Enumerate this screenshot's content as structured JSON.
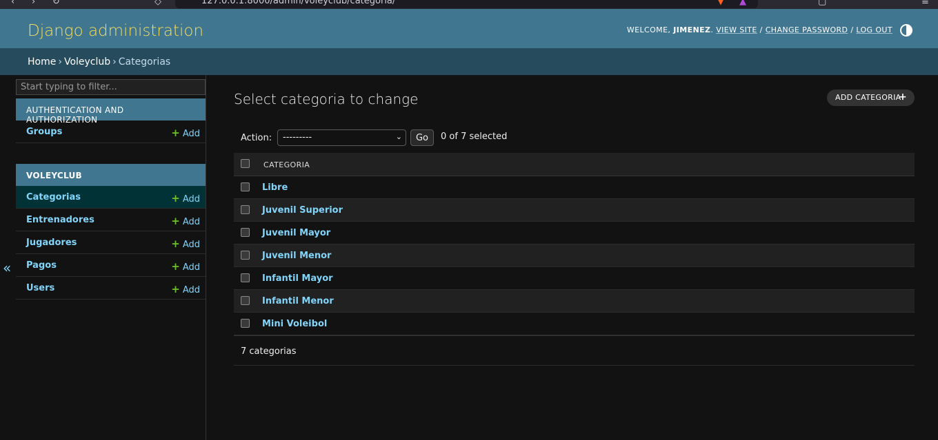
{
  "browser": {
    "url": "127.0.0.1:8000/admin/voleyclub/categoria/"
  },
  "header": {
    "branding": "Django administration",
    "welcome": "WELCOME,",
    "user": "JIMENEZ",
    "view_site": "VIEW SITE",
    "change_password": "CHANGE PASSWORD",
    "log_out": "LOG OUT"
  },
  "breadcrumbs": {
    "home": "Home",
    "app": "Voleyclub",
    "current": "Categorias"
  },
  "sidebar": {
    "filter_placeholder": "Start typing to filter...",
    "modules": [
      {
        "caption": "AUTHENTICATION AND AUTHORIZATION",
        "models": [
          {
            "name": "Groups",
            "add": "Add"
          }
        ]
      },
      {
        "caption": "VOLEYCLUB",
        "models": [
          {
            "name": "Categorias",
            "add": "Add"
          },
          {
            "name": "Entrenadores",
            "add": "Add"
          },
          {
            "name": "Jugadores",
            "add": "Add"
          },
          {
            "name": "Pagos",
            "add": "Add"
          },
          {
            "name": "Users",
            "add": "Add"
          }
        ]
      }
    ],
    "collapse_glyph": "«"
  },
  "content": {
    "title": "Select categoria to change",
    "add_button": "ADD CATEGORIA",
    "action_label": "Action:",
    "action_selected": "---------",
    "go_button": "Go",
    "selection_counter": "0 of 7 selected",
    "column_header": "CATEGORIA",
    "rows": [
      "Libre",
      "Juvenil Superior",
      "Juvenil Mayor",
      "Juvenil Menor",
      "Infantil Mayor",
      "Infantil Menor",
      "Mini Voleibol"
    ],
    "paginator": "7 categorias"
  },
  "colors": {
    "header_bg": "#417690",
    "breadcrumbs_bg": "#264b5d",
    "branding": "#f5dd5d",
    "link": "#81d4fa",
    "add_plus": "#70bf2b",
    "body_bg": "#121212"
  }
}
